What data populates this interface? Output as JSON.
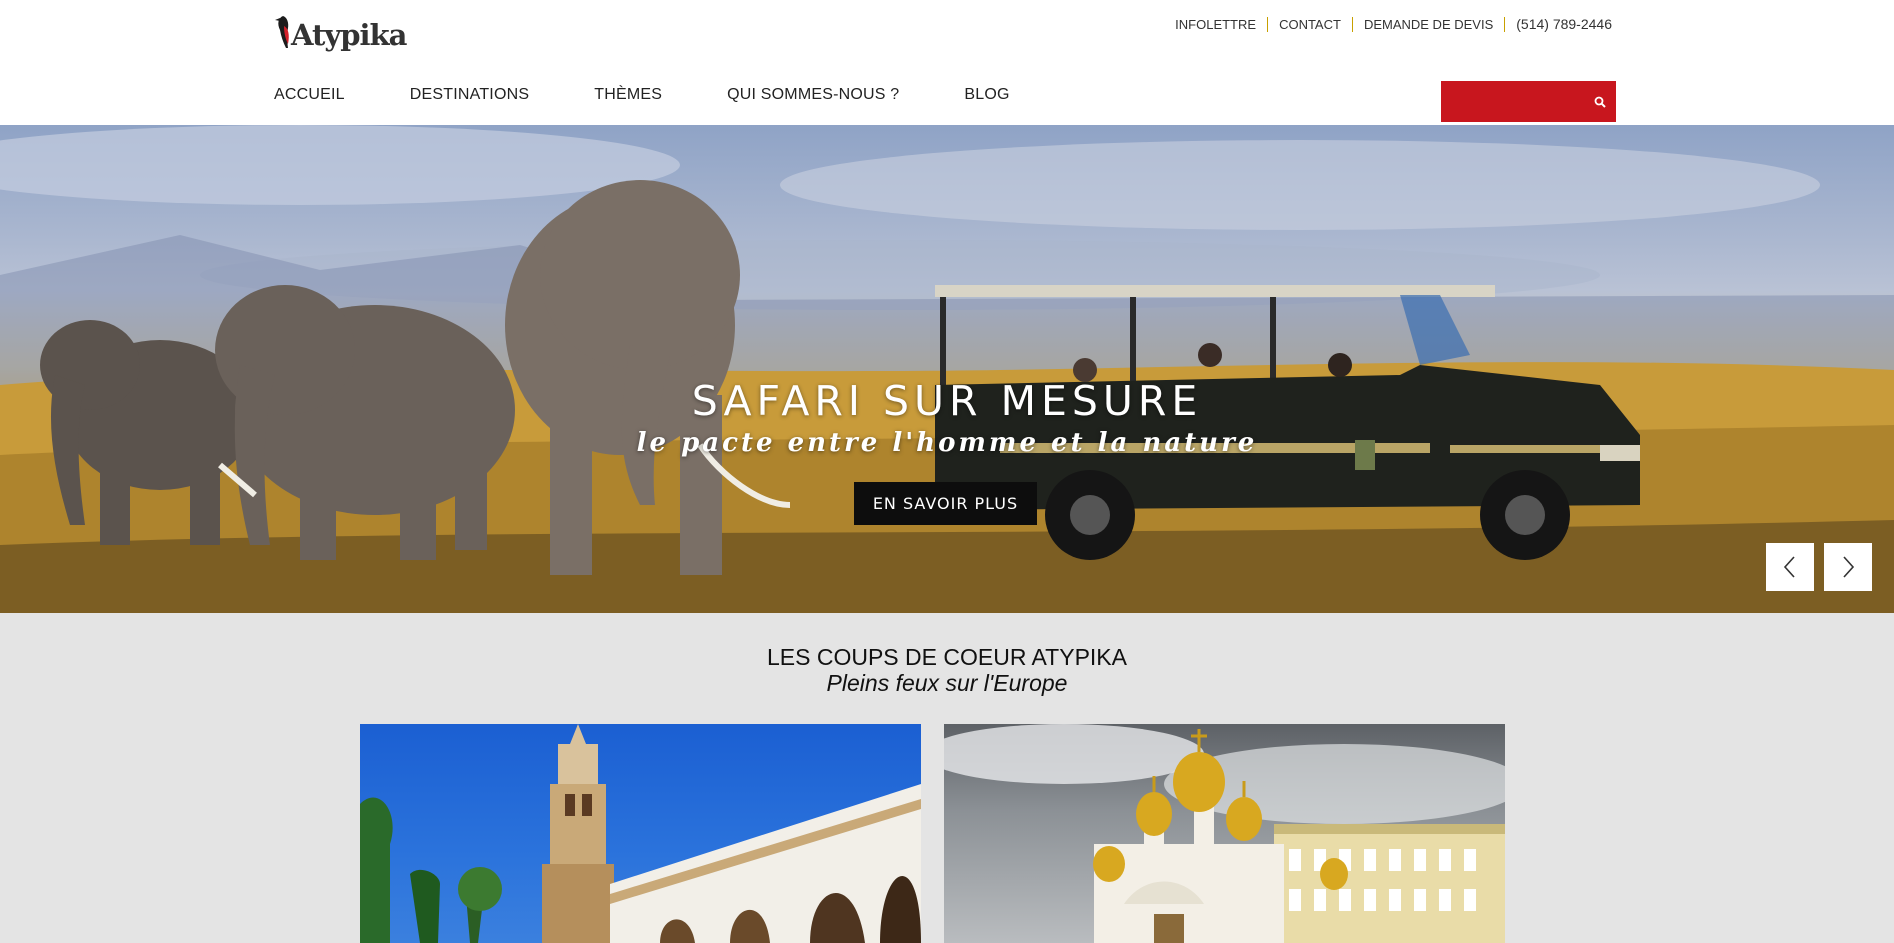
{
  "brand": {
    "name": "Atypika"
  },
  "utility_nav": {
    "items": [
      "INFOLETTRE",
      "CONTACT",
      "DEMANDE DE DEVIS"
    ],
    "phone": "(514) 789-2446",
    "separator_color": "#c8a000"
  },
  "main_nav": {
    "items": [
      "ACCUEIL",
      "DESTINATIONS",
      "THÈMES",
      "QUI SOMMES-NOUS ?",
      "BLOG"
    ]
  },
  "search": {
    "value": "",
    "placeholder": "",
    "icon": "search-icon",
    "background": "#c8161e"
  },
  "hero": {
    "title": "SAFARI  SUR MESURE",
    "subtitle": "le pacte entre l'homme et la nature",
    "cta": "EN SAVOIR PLUS",
    "prev_icon": "chevron-left-icon",
    "next_icon": "chevron-right-icon"
  },
  "featured": {
    "title": "LES COUPS DE COEUR ATYPIKA",
    "subtitle": "Pleins feux sur l'Europe",
    "cards": [
      {
        "image": "cordoba-mosque-bell-tower"
      },
      {
        "image": "moscow-kremlin-cathedral"
      }
    ]
  },
  "colors": {
    "accent": "#c8161e",
    "cta_background": "#0d0d0d",
    "page_background": "#e4e4e4"
  }
}
